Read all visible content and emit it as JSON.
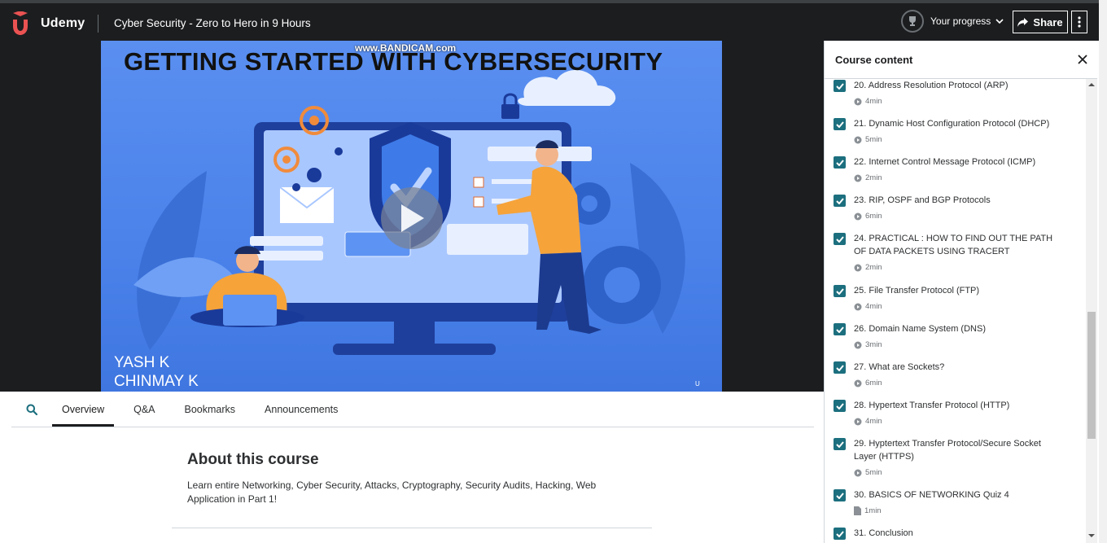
{
  "header": {
    "brand": "Udemy",
    "course_title": "Cyber Security - Zero to Hero in 9 Hours",
    "progress_label": "Your progress",
    "share_label": "Share"
  },
  "video": {
    "heading": "GETTING STARTED WITH CYBERSECURITY",
    "watermark": "www.BANDICAM.com",
    "authors": [
      "YASH K",
      "CHINMAY K"
    ]
  },
  "tabs": [
    {
      "label": "Overview",
      "active": true
    },
    {
      "label": "Q&A",
      "active": false
    },
    {
      "label": "Bookmarks",
      "active": false
    },
    {
      "label": "Announcements",
      "active": false
    }
  ],
  "about": {
    "title": "About this course",
    "description": "Learn entire Networking, Cyber Security, Attacks, Cryptography, Security Audits, Hacking, Web Application in Part 1!"
  },
  "sidebar": {
    "title": "Course content",
    "lectures": [
      {
        "title": "20. Address Resolution Protocol (ARP)",
        "duration": "4min",
        "type": "video",
        "checked": true
      },
      {
        "title": "21. Dynamic Host Configuration Protocol (DHCP)",
        "duration": "5min",
        "type": "video",
        "checked": true
      },
      {
        "title": "22. Internet Control Message Protocol (ICMP)",
        "duration": "2min",
        "type": "video",
        "checked": true
      },
      {
        "title": "23. RIP, OSPF and BGP Protocols",
        "duration": "6min",
        "type": "video",
        "checked": true
      },
      {
        "title": "24. PRACTICAL : HOW TO FIND OUT THE PATH OF DATA PACKETS USING TRACERT",
        "duration": "2min",
        "type": "video",
        "checked": true
      },
      {
        "title": "25. File Transfer Protocol (FTP)",
        "duration": "4min",
        "type": "video",
        "checked": true
      },
      {
        "title": "26. Domain Name System (DNS)",
        "duration": "3min",
        "type": "video",
        "checked": true
      },
      {
        "title": "27. What are Sockets?",
        "duration": "6min",
        "type": "video",
        "checked": true
      },
      {
        "title": "28. Hypertext Transfer Protocol (HTTP)",
        "duration": "4min",
        "type": "video",
        "checked": true
      },
      {
        "title": "29. Hyptertext Transfer Protocol/Secure Socket Layer (HTTPS)",
        "duration": "5min",
        "type": "video",
        "checked": true
      },
      {
        "title": "30. BASICS OF NETWORKING Quiz 4",
        "duration": "1min",
        "type": "quiz",
        "checked": true
      },
      {
        "title": "31. Conclusion",
        "duration": "",
        "type": "video",
        "checked": true
      }
    ]
  },
  "colors": {
    "header_bg": "#1c1d1f",
    "checkbox": "#1c6f7e",
    "brand_red": "#ea5252"
  }
}
